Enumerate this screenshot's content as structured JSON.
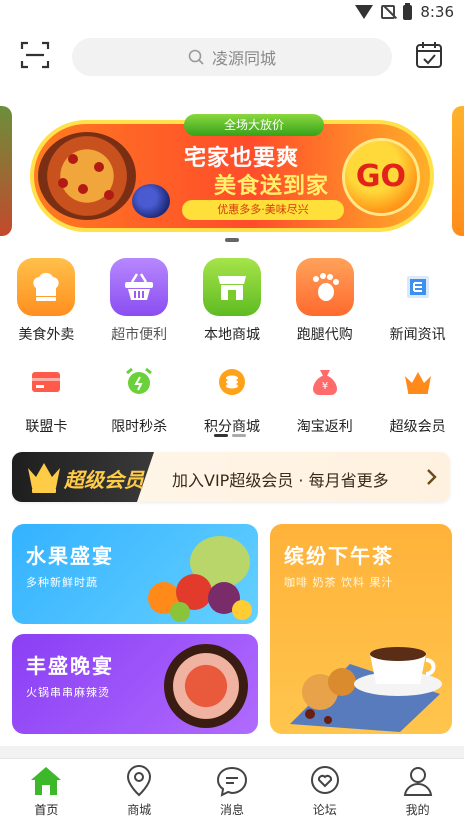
{
  "status_bar": {
    "time": "8:36"
  },
  "header": {
    "search_placeholder": "凌源同城"
  },
  "banner": {
    "tag": "全场大放价",
    "line1": "宅家也要爽",
    "line2": "美食送到家",
    "line3": "优惠多多·美味尽兴",
    "go": "GO"
  },
  "nav_primary": [
    {
      "label": "美食外卖",
      "icon": "chef-hat-icon",
      "color": "#ff9c2a"
    },
    {
      "label": "超市便利",
      "icon": "basket-icon",
      "color": "#9c5cf0"
    },
    {
      "label": "本地商城",
      "icon": "store-icon",
      "color": "#7ccb2a"
    },
    {
      "label": "跑腿代购",
      "icon": "footprint-icon",
      "color": "#ff7a3a"
    },
    {
      "label": "新闻资讯",
      "icon": "newspaper-icon",
      "color": "#3d8ff0"
    }
  ],
  "nav_secondary": [
    {
      "label": "联盟卡",
      "icon": "card-icon",
      "color": "#ff5a4a"
    },
    {
      "label": "限时秒杀",
      "icon": "alarm-clock-icon",
      "color": "#5ccb3a"
    },
    {
      "label": "积分商城",
      "icon": "coins-icon",
      "color": "#ffa21a"
    },
    {
      "label": "淘宝返利",
      "icon": "money-bag-icon",
      "color": "#ff5a5a"
    },
    {
      "label": "超级会员",
      "icon": "crown-icon",
      "color": "#ff8a1a"
    }
  ],
  "vip": {
    "badge": "超级会员",
    "text": "加入VIP超级会员 · 每月省更多"
  },
  "promos": {
    "fruit": {
      "title": "水果盛宴",
      "sub": "多种新鲜时蔬"
    },
    "dinner": {
      "title": "丰盛晚宴",
      "sub": "火锅串串麻辣烫"
    },
    "tea": {
      "title": "缤纷下午茶",
      "sub": "咖啡 奶茶 饮料 果汁"
    }
  },
  "tabs": [
    {
      "label": "首页",
      "icon": "home-icon",
      "active": true
    },
    {
      "label": "商城",
      "icon": "map-pin-icon"
    },
    {
      "label": "消息",
      "icon": "chat-bubble-icon"
    },
    {
      "label": "论坛",
      "icon": "heart-bubble-icon"
    },
    {
      "label": "我的",
      "icon": "user-icon"
    }
  ]
}
